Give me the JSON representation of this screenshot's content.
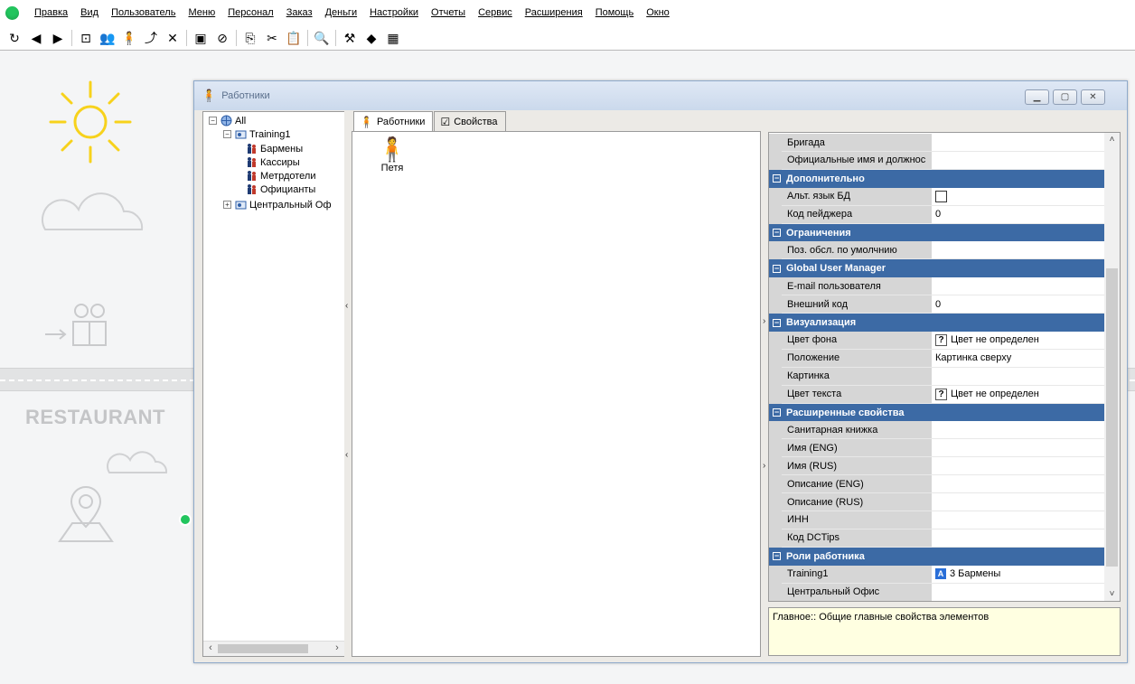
{
  "menu": [
    "Правка",
    "Вид",
    "Пользователь",
    "Меню",
    "Персонал",
    "Заказ",
    "Деньги",
    "Настройки",
    "Отчеты",
    "Сервис",
    "Расширения",
    "Помощь",
    "Окно"
  ],
  "toolbar": {
    "icons": [
      {
        "name": "refresh-icon",
        "glyph": "↻"
      },
      {
        "name": "back-icon",
        "glyph": "◀"
      },
      {
        "name": "forward-icon",
        "glyph": "▶"
      },
      {
        "sep": true
      },
      {
        "name": "new-group-icon",
        "glyph": "⊡"
      },
      {
        "name": "people-icon",
        "glyph": "👥"
      },
      {
        "name": "person-icon",
        "glyph": "🧍"
      },
      {
        "name": "export-icon",
        "glyph": "⤴"
      },
      {
        "name": "delete-icon",
        "glyph": "✕"
      },
      {
        "sep": true
      },
      {
        "name": "save-icon",
        "glyph": "▣"
      },
      {
        "name": "cancel-icon",
        "glyph": "⊘"
      },
      {
        "sep": true
      },
      {
        "name": "copy-icon",
        "glyph": "⎘"
      },
      {
        "name": "cut-icon",
        "glyph": "✂"
      },
      {
        "name": "paste-icon",
        "glyph": "📋"
      },
      {
        "sep": true
      },
      {
        "name": "search-icon",
        "glyph": "🔍"
      },
      {
        "sep": true
      },
      {
        "name": "tools-icon",
        "glyph": "⚒"
      },
      {
        "name": "color-icon",
        "glyph": "◆"
      },
      {
        "name": "table-view-icon",
        "glyph": "▦"
      }
    ]
  },
  "background": {
    "restaurant": "RESTAURANT"
  },
  "window": {
    "title": "Работники",
    "tree": {
      "root": "All",
      "node1": "Training1",
      "children": [
        "Бармены",
        "Кассиры",
        "Метрдотели",
        "Официанты"
      ],
      "node2": "Центральный Оф"
    },
    "tabs": [
      "Работники",
      "Свойства"
    ],
    "employee": "Петя",
    "properties": [
      {
        "name": "Бригада",
        "value": ""
      },
      {
        "name": "Официальные имя и должнос",
        "value": ""
      },
      {
        "category": "Дополнительно"
      },
      {
        "name": "Альт. язык БД",
        "value": "",
        "checkbox": true
      },
      {
        "name": "Код пейджера",
        "value": "0"
      },
      {
        "category": "Ограничения"
      },
      {
        "name": "Поз. обсл. по умолчнию",
        "value": ""
      },
      {
        "category": "Global User Manager"
      },
      {
        "name": "E-mail пользователя",
        "value": ""
      },
      {
        "name": "Внешний код",
        "value": "0"
      },
      {
        "category": "Визуализация"
      },
      {
        "name": "Цвет фона",
        "value": "Цвет не определен",
        "qmark": "?"
      },
      {
        "name": "Положение",
        "value": "Картинка сверху"
      },
      {
        "name": "Картинка",
        "value": ""
      },
      {
        "name": "Цвет текста",
        "value": "Цвет не определен",
        "qmark": "?"
      },
      {
        "category": "Расширенные свойства"
      },
      {
        "name": "Санитарная книжка",
        "value": ""
      },
      {
        "name": "Имя (ENG)",
        "value": ""
      },
      {
        "name": "Имя (RUS)",
        "value": ""
      },
      {
        "name": "Описание (ENG)",
        "value": ""
      },
      {
        "name": "Описание (RUS)",
        "value": ""
      },
      {
        "name": "ИНН",
        "value": ""
      },
      {
        "name": "Код DCTips",
        "value": ""
      },
      {
        "category": "Роли работника"
      },
      {
        "name": "Training1",
        "value": "3 Бармены",
        "abadge": "A"
      },
      {
        "name": "Центральный Офис",
        "value": ""
      }
    ],
    "description": "Главное:: Общие главные свойства элементов"
  }
}
